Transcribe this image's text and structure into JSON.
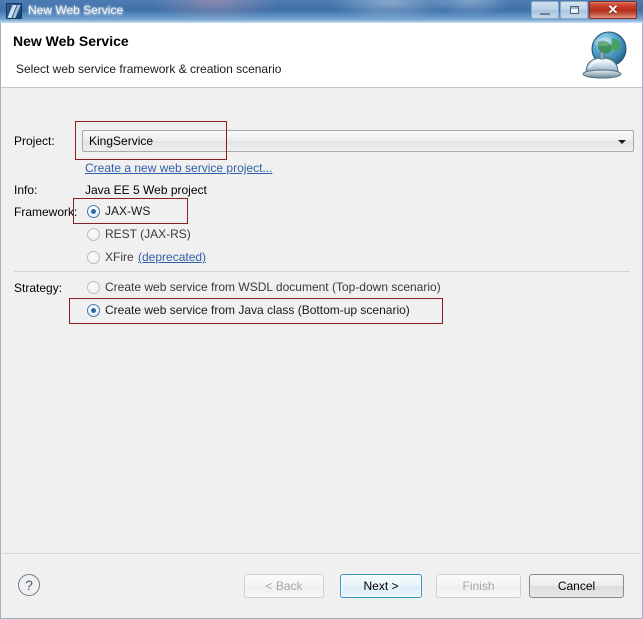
{
  "window": {
    "title": "New Web Service",
    "icon": "new-web-service-icon",
    "controls": {
      "minimize": "minimize-icon",
      "maximize": "maximize-icon",
      "close": "✕"
    }
  },
  "header": {
    "title": "New Web Service",
    "subtitle": "Select web service framework & creation scenario",
    "icon": "globe-server-icon"
  },
  "form": {
    "project": {
      "label": "Project:",
      "value": "KingService",
      "dropdown_icon": "chevron-down-icon"
    },
    "create_project_link": "Create a new web service project...",
    "info": {
      "label": "Info:",
      "value": "Java EE 5 Web project"
    },
    "framework": {
      "label": "Framework:",
      "options": [
        {
          "label": "JAX-WS",
          "selected": true,
          "enabled": true
        },
        {
          "label": "REST (JAX-RS)",
          "selected": false,
          "enabled": false
        },
        {
          "label": "XFire",
          "selected": false,
          "enabled": false,
          "link": "(deprecated)"
        }
      ]
    },
    "strategy": {
      "label": "Strategy:",
      "options": [
        {
          "label": "Create web service from WSDL document (Top-down scenario)",
          "selected": false,
          "enabled": false
        },
        {
          "label": "Create web service from Java class (Bottom-up scenario)",
          "selected": true,
          "enabled": true
        }
      ]
    }
  },
  "footer": {
    "help": "?",
    "buttons": [
      {
        "label": "< Back",
        "state": "disabled"
      },
      {
        "label": "Next >",
        "state": "default"
      },
      {
        "label": "Finish",
        "state": "disabled"
      },
      {
        "label": "Cancel",
        "state": "normal"
      }
    ]
  },
  "annotations": {
    "color": "#8b1f1f",
    "boxes": [
      "project-combo-highlight",
      "framework-jaxws-highlight",
      "strategy-bottomup-highlight"
    ]
  }
}
